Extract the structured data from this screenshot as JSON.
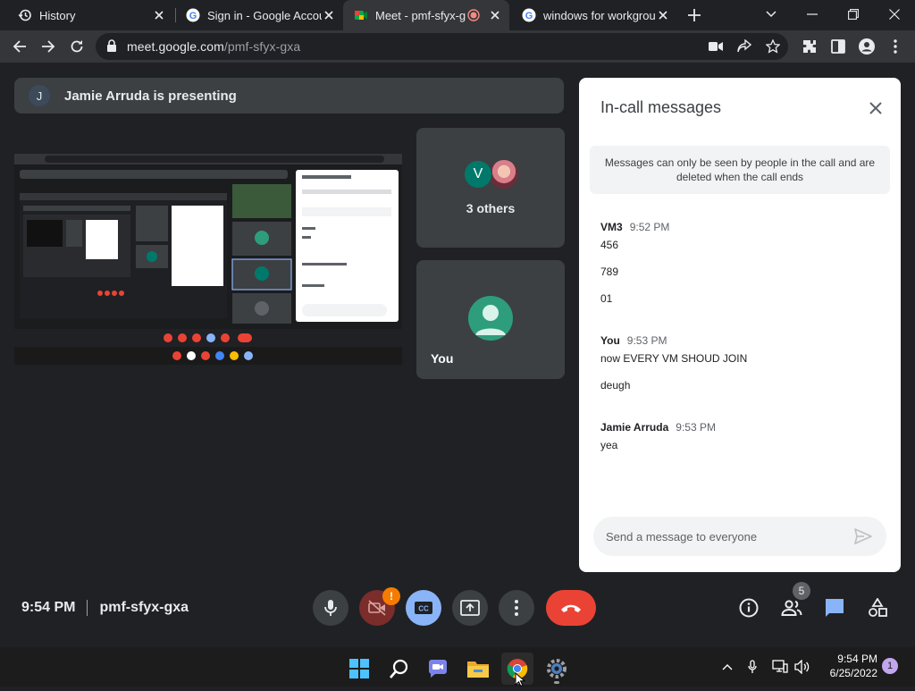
{
  "browser": {
    "tabs": [
      {
        "title": "History",
        "icon": "history-icon"
      },
      {
        "title": "Sign in - Google Accou",
        "icon": "google-icon"
      },
      {
        "title": "Meet - pmf-sfyx-g",
        "icon": "meet-icon",
        "active": true,
        "recording": true
      },
      {
        "title": "windows for workgroup",
        "icon": "google-icon"
      }
    ],
    "url_host": "meet.google.com",
    "url_path": "/pmf-sfyx-gxa"
  },
  "meet": {
    "presenter_initial": "J",
    "presenting_text": "Jamie Arruda is presenting",
    "others_initial": "V",
    "others_label": "3 others",
    "self_label": "You",
    "meeting_time": "9:54 PM",
    "meeting_code": "pmf-sfyx-gxa",
    "camera_alert": "!",
    "people_count": "5"
  },
  "chat": {
    "title": "In-call messages",
    "notice": "Messages can only be seen by people in the call and are deleted when the call ends",
    "groups": [
      {
        "sender": "VM3",
        "time": "9:52 PM",
        "lines": [
          "456",
          "789",
          "01"
        ]
      },
      {
        "sender": "You",
        "time": "9:53 PM",
        "lines": [
          "now EVERY VM SHOUD JOIN",
          "deugh"
        ]
      },
      {
        "sender": "Jamie Arruda",
        "time": "9:53 PM",
        "lines": [
          "yea"
        ]
      }
    ],
    "placeholder": "Send a message to everyone"
  },
  "taskbar": {
    "time": "9:54 PM",
    "date": "6/25/2022",
    "notifications": "1"
  },
  "colors": {
    "background": "#202124",
    "tile": "#3c4043",
    "end_call": "#ea4335",
    "captions_active": "#8ab4f8",
    "chat_active": "#8ab4f8"
  }
}
